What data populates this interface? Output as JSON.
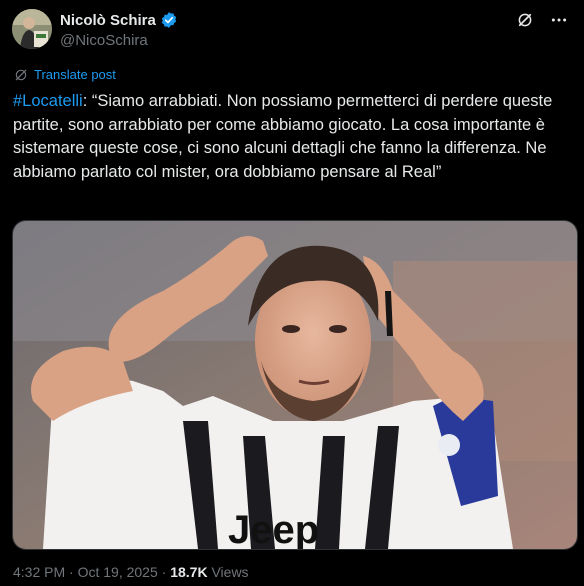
{
  "author": {
    "display_name": "Nicolò Schira",
    "handle": "@NicoSchira",
    "verified_icon": "verified-badge-icon",
    "avatar_icon": "avatar"
  },
  "header_icons": [
    "grok-icon",
    "more-icon"
  ],
  "translate": {
    "label": "Translate post",
    "icon": "translate-icon"
  },
  "post": {
    "hashtag": "#Locatelli",
    "text": ": “Siamo arrabbiati. Non possiamo permetterci di perdere queste partite, sono arrabbiato per come abbiamo giocato. La cosa importante è sistemare queste cose, ci sono alcuni dettagli che fanno la differenza. Ne abbiamo parlato col mister, ora dobbiamo pensare al Real”"
  },
  "media": {
    "shirt_text": "Jeep"
  },
  "meta": {
    "time": "4:32 PM",
    "sep1": " · ",
    "date": "Oct 19, 2025",
    "sep2": " · ",
    "views_count": "18.7K",
    "views_label": " Views"
  },
  "colors": {
    "background": "#000000",
    "accent": "#1d9bf0",
    "text": "#e7e9ea",
    "muted": "#71767b"
  }
}
